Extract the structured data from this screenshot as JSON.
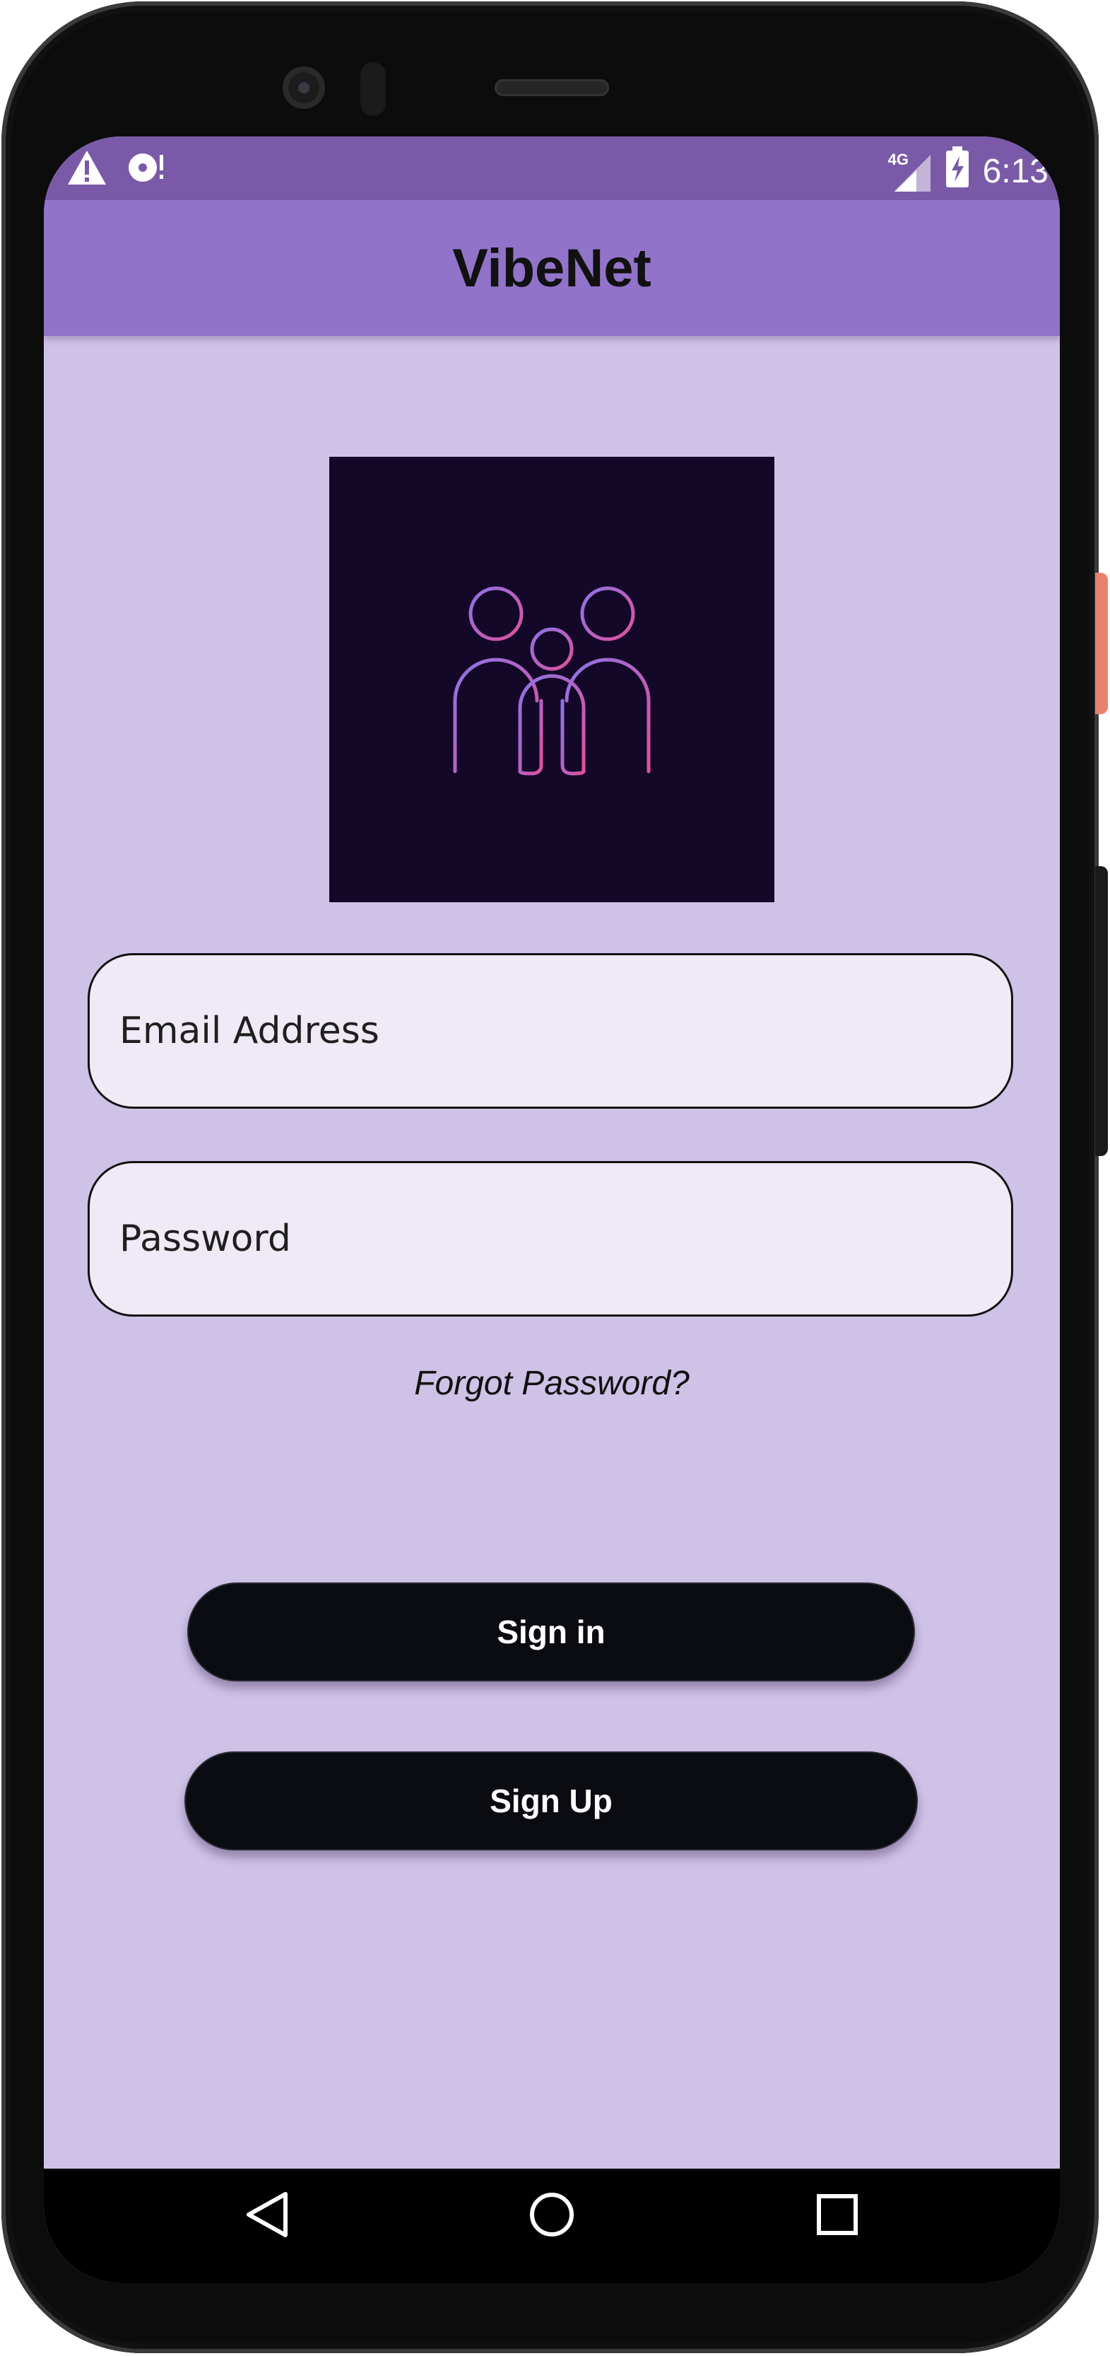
{
  "status_bar": {
    "time": "6:13",
    "network": "4G",
    "icons": [
      "warning-icon",
      "sync-disc-icon",
      "signal-icon",
      "battery-charging-icon"
    ]
  },
  "app_bar": {
    "title": "VibeNet"
  },
  "logo": {
    "icon": "family-people-icon",
    "background": "#140828",
    "gradient_start": "#8b74e8",
    "gradient_end": "#e2509a"
  },
  "login_form": {
    "email_placeholder": "Email Address",
    "email_value": "",
    "password_placeholder": "Password",
    "password_value": "",
    "forgot_password_label": "Forgot Password?"
  },
  "actions": {
    "sign_in_label": "Sign in",
    "sign_up_label": "Sign Up"
  },
  "nav_bar": {
    "items": [
      "back-icon",
      "home-icon",
      "recents-icon"
    ]
  },
  "colors": {
    "screen_background": "#cfc2e7",
    "app_bar": "#9174c9",
    "status_bar": "#7a5aa8",
    "button": "#0b0b12",
    "field_background": "#efeaf6"
  }
}
